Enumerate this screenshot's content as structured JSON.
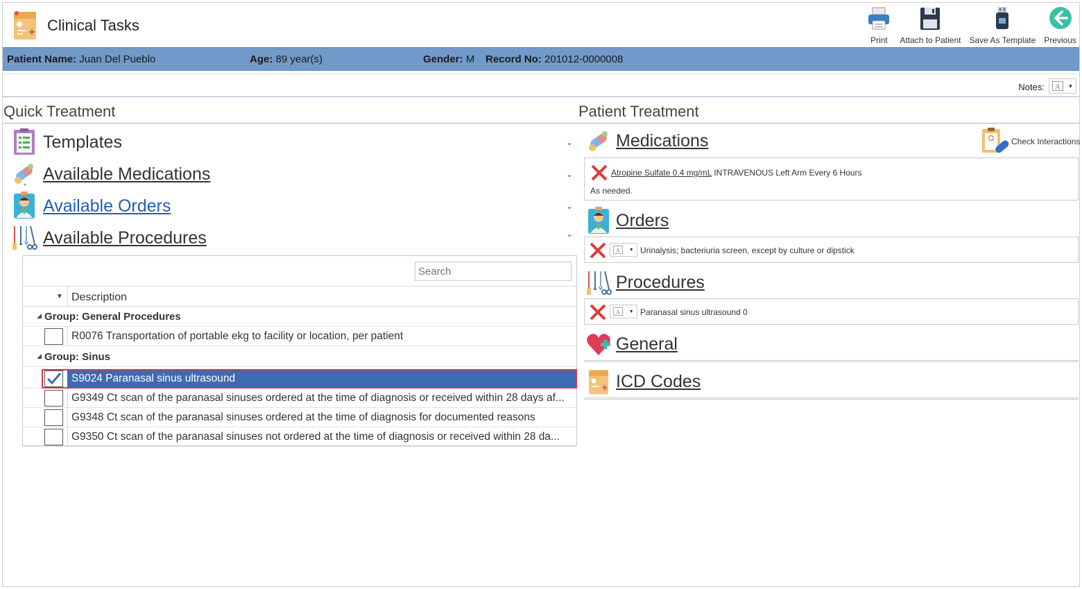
{
  "app": {
    "title": "Clinical Tasks"
  },
  "toolbar": {
    "print": "Print",
    "attach": "Attach to Patient",
    "save_template": "Save As Template",
    "previous": "Previous"
  },
  "patient": {
    "name_label": "Patient Name:",
    "name": "Juan Del Pueblo",
    "age_label": "Age:",
    "age": "89 year(s)",
    "gender_label": "Gender:",
    "gender": "M",
    "record_label": "Record No:",
    "record": "201012-0000008"
  },
  "notes": {
    "label": "Notes:"
  },
  "quick_treatment": {
    "title": "Quick Treatment",
    "sections": [
      {
        "label": "Templates",
        "icon": "clipboard-list-icon",
        "expanded": false
      },
      {
        "label": "Available Medications",
        "icon": "pills-icon",
        "expanded": false
      },
      {
        "label": "Available Orders",
        "icon": "doctor-icon",
        "expanded": false
      },
      {
        "label": "Available Procedures",
        "icon": "surgical-tools-icon",
        "expanded": true
      }
    ],
    "grid": {
      "search_placeholder": "Search",
      "column_description": "Description",
      "groups": [
        {
          "label": "Group: General Procedures",
          "rows": [
            {
              "text": "R0076 Transportation of portable ekg to facility or location, per patient",
              "checked": false
            }
          ]
        },
        {
          "label": "Group: Sinus",
          "rows": [
            {
              "text": "S9024 Paranasal sinus ultrasound",
              "checked": true,
              "selected": true
            },
            {
              "text": "G9349 Ct scan of the paranasal sinuses ordered at the time of diagnosis or received within 28 days af...",
              "checked": false
            },
            {
              "text": "G9348 Ct scan of the paranasal sinuses ordered at the time of diagnosis for documented reasons",
              "checked": false
            },
            {
              "text": "G9350 Ct scan of the paranasal sinuses not ordered at the time of diagnosis or received within 28 da...",
              "checked": false
            }
          ]
        }
      ]
    }
  },
  "patient_treatment": {
    "title": "Patient Treatment",
    "check_interactions": "Check Interactions",
    "medications": {
      "label": "Medications",
      "items": [
        {
          "name": "Atropine Sulfate  0.4 mg/mL",
          "detail": "INTRAVENOUS Left Arm Every 6 Hours",
          "note": "As needed."
        }
      ]
    },
    "orders": {
      "label": "Orders",
      "items": [
        {
          "text": "Urinalysis; bacteriuria screen, except by culture or dipstick"
        }
      ]
    },
    "procedures": {
      "label": "Procedures",
      "items": [
        {
          "text": "Paranasal sinus ultrasound 0"
        }
      ]
    },
    "general": {
      "label": "General"
    },
    "icd_codes": {
      "label": "ICD Codes"
    }
  },
  "colors": {
    "patient_bar": "#7199c9",
    "selection": "#3e6ab0",
    "selection_outline": "#d6394a",
    "remove_x": "#e03a3a",
    "link_blue": "#1f5fb5"
  }
}
